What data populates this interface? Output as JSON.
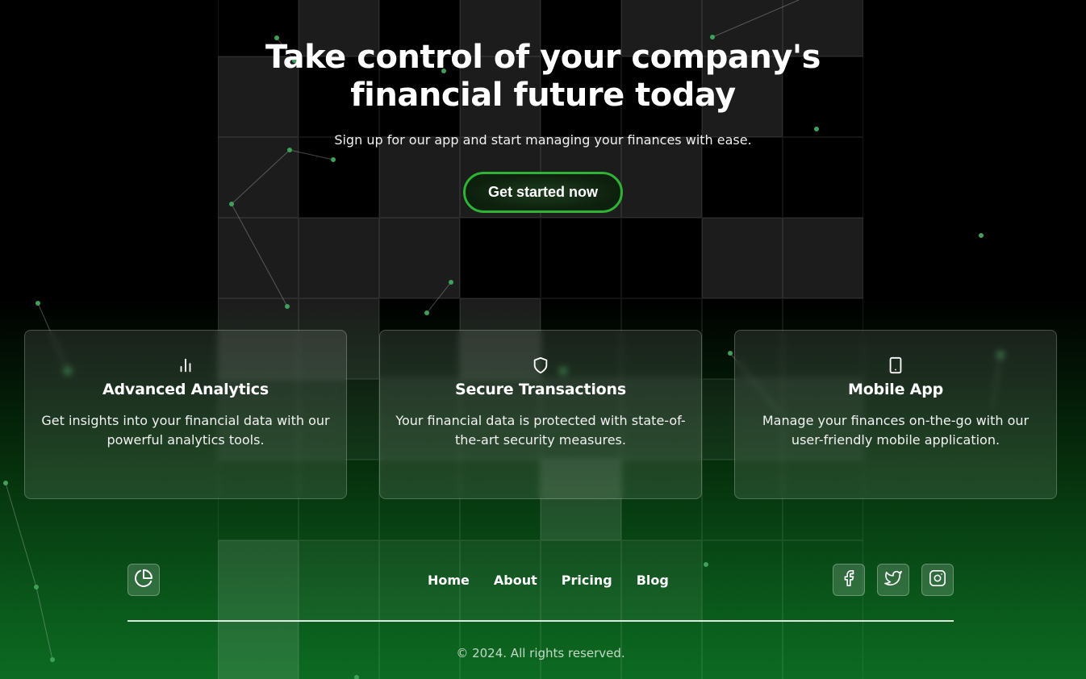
{
  "hero": {
    "title": "Take control of your company's financial future today",
    "subtitle": "Sign up for our app and start managing your finances with ease.",
    "cta_label": "Get started now"
  },
  "features": [
    {
      "icon": "bar-chart-icon",
      "title": "Advanced Analytics",
      "text": "Get insights into your financial data with our powerful analytics tools."
    },
    {
      "icon": "shield-icon",
      "title": "Secure Transactions",
      "text": "Your financial data is protected with state-of-the-art security measures."
    },
    {
      "icon": "smartphone-icon",
      "title": "Mobile App",
      "text": "Manage your finances on-the-go with our user-friendly mobile application."
    }
  ],
  "footer": {
    "logo_icon": "pie-chart-icon",
    "nav": [
      "Home",
      "About",
      "Pricing",
      "Blog"
    ],
    "social": [
      "facebook-icon",
      "twitter-icon",
      "instagram-icon"
    ],
    "copyright": "© 2024. All rights reserved."
  },
  "colors": {
    "accent": "#2fb335",
    "particle": "#3fa05a",
    "background_top": "#000000",
    "background_bottom": "#0d6b22"
  }
}
